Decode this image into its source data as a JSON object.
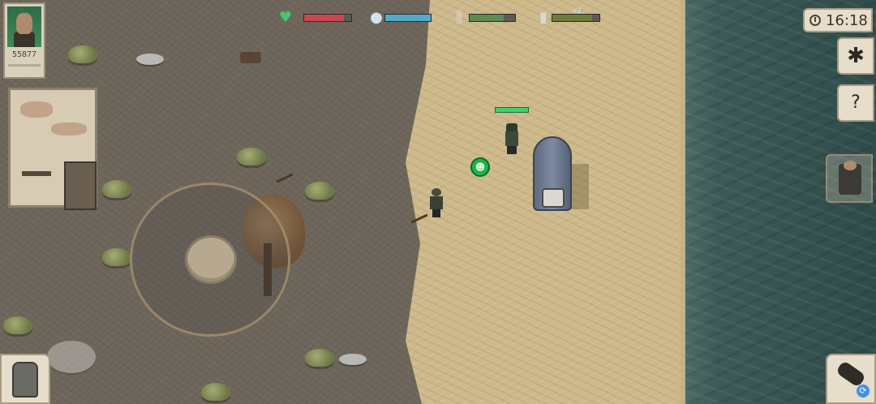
{
  "hud": {
    "score": "55877",
    "time": "16:18",
    "stats": [
      {
        "name": "health",
        "icon": "heart-icon",
        "glyph": "♥",
        "level": 0.85,
        "color": "#c9474f",
        "icon_color": "#47c86a"
      },
      {
        "name": "thirst",
        "icon": "water-drop-icon",
        "glyph": "💧",
        "level": 1.0,
        "color": "#55a8c8",
        "icon_color": "#cfe3ee"
      },
      {
        "name": "hunger",
        "icon": "fork-knife-icon",
        "glyph": "🍴",
        "level": 0.75,
        "color": "#5b8a55",
        "icon_color": "#d8d8d8"
      },
      {
        "name": "temperature",
        "icon": "thermometer-icon",
        "glyph": "🌡",
        "level": 0.85,
        "color": "#6f7a3a",
        "icon_color": "#d8d8d8",
        "label": "+2"
      }
    ]
  },
  "player": {
    "health_level": 1.0
  },
  "colors": {
    "sand": "#cdb98b",
    "dirt": "#6e665b",
    "water": "#3c5a57",
    "marker": "#1fb34a"
  }
}
